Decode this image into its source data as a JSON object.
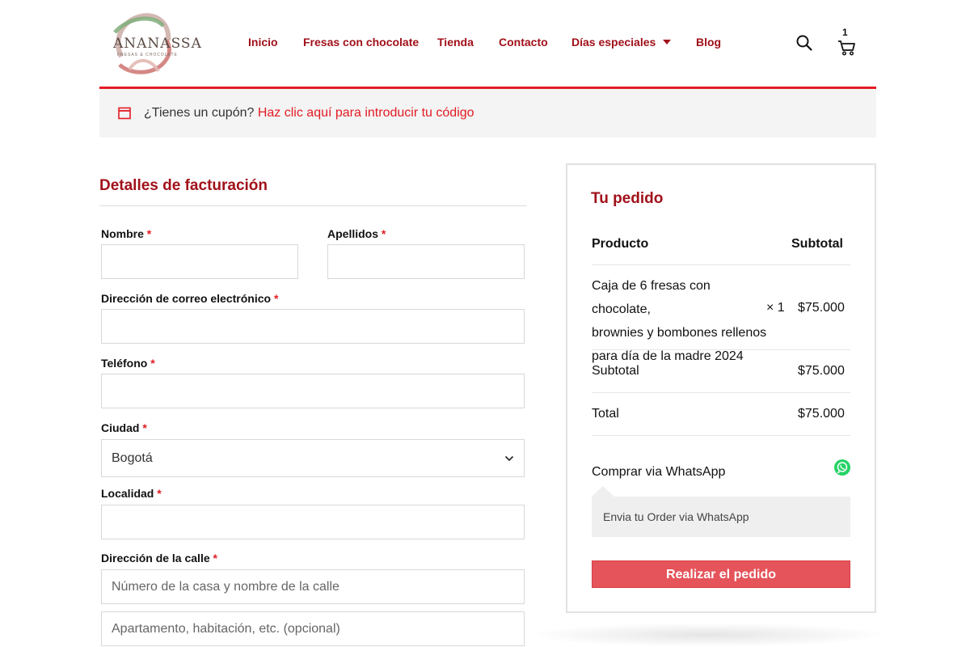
{
  "brand": {
    "logo_text": "ANANASSA",
    "logo_sub": "FRESAS & CHOCOLATE"
  },
  "nav": {
    "items": [
      {
        "label": "Inicio"
      },
      {
        "label": "Fresas con chocolate"
      },
      {
        "label": "Tienda"
      },
      {
        "label": "Contacto"
      },
      {
        "label": "Días especiales"
      },
      {
        "label": "Blog"
      }
    ],
    "cart_count": "1"
  },
  "coupon": {
    "question": "¿Tienes un cupón?",
    "link": "Haz clic aquí para introducir tu código"
  },
  "billing": {
    "title": "Detalles de facturación",
    "required_mark": "*",
    "fields": {
      "first_name": {
        "label": "Nombre"
      },
      "last_name": {
        "label": "Apellidos"
      },
      "email": {
        "label": "Dirección de correo electrónico"
      },
      "phone": {
        "label": "Teléfono"
      },
      "city": {
        "label": "Ciudad",
        "value": "Bogotá"
      },
      "locality": {
        "label": "Localidad"
      },
      "street": {
        "label": "Dirección de la calle",
        "placeholder": "Número de la casa y nombre de la calle",
        "placeholder_2": "Apartamento, habitación, etc. (opcional)"
      }
    }
  },
  "order": {
    "title": "Tu pedido",
    "col_product": "Producto",
    "col_subtotal": "Subtotal",
    "item": {
      "name_line1": "Caja de 6 fresas con chocolate,",
      "name_line2": "brownies y bombones rellenos",
      "name_line3": "para día de la madre 2024",
      "qty": "× 1",
      "price": "$75.000"
    },
    "subtotal_label": "Subtotal",
    "subtotal_value": "$75.000",
    "total_label": "Total",
    "total_value": "$75.000",
    "whatsapp_label": "Comprar via WhatsApp",
    "whatsapp_desc": "Envia tu Order via WhatsApp",
    "place_order": "Realizar el pedido"
  },
  "colors": {
    "brand_red": "#a1111a",
    "accent_red": "#e31b23",
    "button_red": "#e4545a",
    "whatsapp_green": "#25d366"
  },
  "icons": {
    "search": "search-icon",
    "cart": "cart-icon",
    "coupon": "calendar-icon",
    "select": "chevron-down-icon",
    "whatsapp": "whatsapp-icon"
  }
}
